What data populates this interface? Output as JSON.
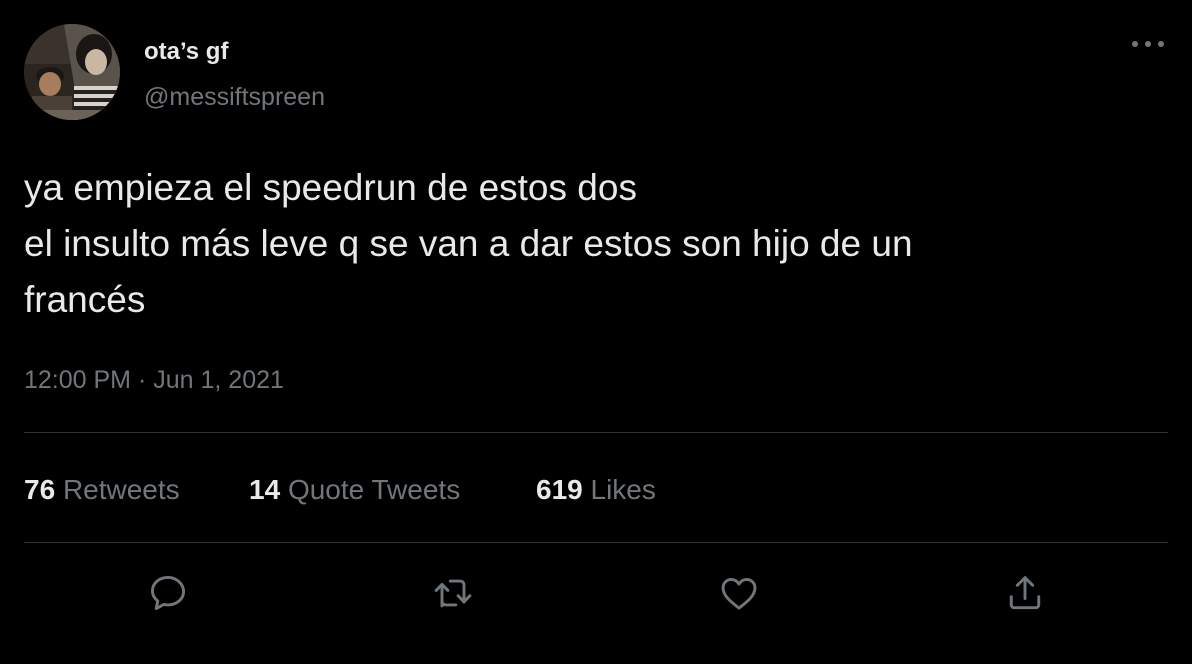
{
  "author": {
    "display_name": "ota’s gf",
    "handle": "@messiftspreen"
  },
  "tweet": {
    "text": "ya empieza el speedrun de estos dos\nel insulto más leve q se van a dar estos son hijo de un\nfrancés",
    "time": "12:00 PM",
    "separator": "·",
    "date": "Jun 1, 2021"
  },
  "stats": {
    "retweets": {
      "count": "76",
      "label": "Retweets"
    },
    "quote_tweets": {
      "count": "14",
      "label": "Quote Tweets"
    },
    "likes": {
      "count": "619",
      "label": "Likes"
    }
  },
  "actions": [
    {
      "name": "reply",
      "icon": "reply-icon"
    },
    {
      "name": "retweet",
      "icon": "retweet-icon"
    },
    {
      "name": "like",
      "icon": "heart-icon"
    },
    {
      "name": "share",
      "icon": "share-icon"
    }
  ],
  "colors": {
    "background": "#000000",
    "primary_text": "#e7e9ea",
    "secondary_text": "#71767b",
    "divider": "#2f3336"
  }
}
